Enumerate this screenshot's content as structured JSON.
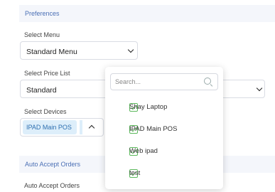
{
  "preferences": {
    "section_title": "Preferences"
  },
  "select_menu": {
    "label": "Select Menu",
    "value": "Standard Menu"
  },
  "select_price_list": {
    "label": "Select Price List",
    "value": "Standard"
  },
  "select_devices": {
    "label": "Select Devices",
    "selected_chip": "IPAD Main POS",
    "dropdown": {
      "search_placeholder": "Search...",
      "options": [
        {
          "label": "Shay Laptop",
          "checked": true
        },
        {
          "label": "IPAD Main POS",
          "checked": true
        },
        {
          "label": "Web ipad",
          "checked": true
        },
        {
          "label": "test",
          "checked": true
        }
      ]
    }
  },
  "auto_accept": {
    "section_title": "Auto Accept Orders",
    "label": "Auto Accept Orders"
  },
  "colors": {
    "accent": "#4a6fb5",
    "check": "#5cb85c",
    "chip_bg": "#ddeefa"
  }
}
